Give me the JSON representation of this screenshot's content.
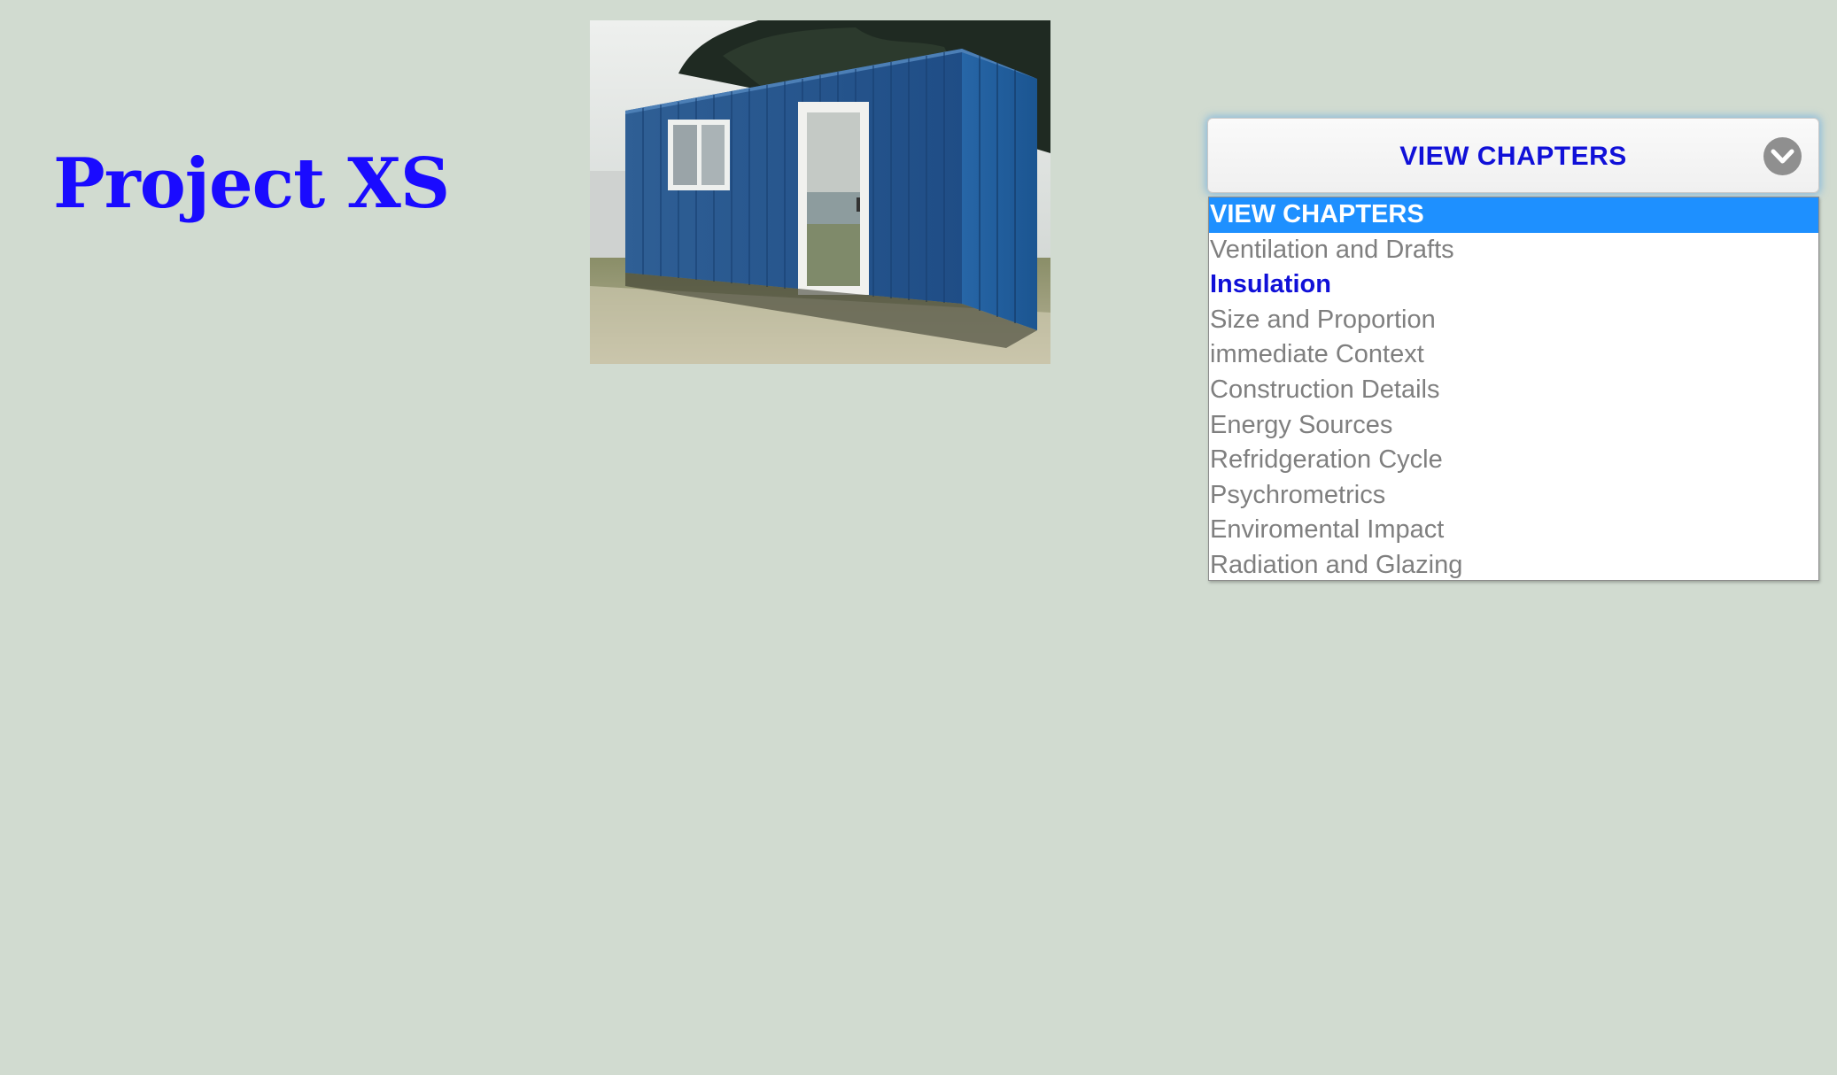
{
  "site": {
    "title": "Project XS"
  },
  "hero_image": {
    "subject": "blue shipping container cabin with window and glass door"
  },
  "chapter_select": {
    "selected_label": "VIEW CHAPTERS",
    "icon": "chevron-down-circle-icon",
    "options": [
      {
        "label": "VIEW CHAPTERS",
        "state": "highlighted"
      },
      {
        "label": "Ventilation and Drafts",
        "state": "normal"
      },
      {
        "label": "Insulation",
        "state": "current"
      },
      {
        "label": "Size and Proportion",
        "state": "normal"
      },
      {
        "label": "immediate Context",
        "state": "normal"
      },
      {
        "label": "Construction Details",
        "state": "normal"
      },
      {
        "label": "Energy Sources",
        "state": "normal"
      },
      {
        "label": "Refridgeration Cycle",
        "state": "normal"
      },
      {
        "label": "Psychrometrics",
        "state": "normal"
      },
      {
        "label": "Enviromental Impact",
        "state": "normal"
      },
      {
        "label": "Radiation and Glazing",
        "state": "normal"
      }
    ]
  },
  "colors": {
    "background": "#d1dbd0",
    "title": "#1a0bff",
    "select_text": "#1010d8",
    "highlight": "#1e90ff",
    "option_text": "#7f7f7f"
  }
}
